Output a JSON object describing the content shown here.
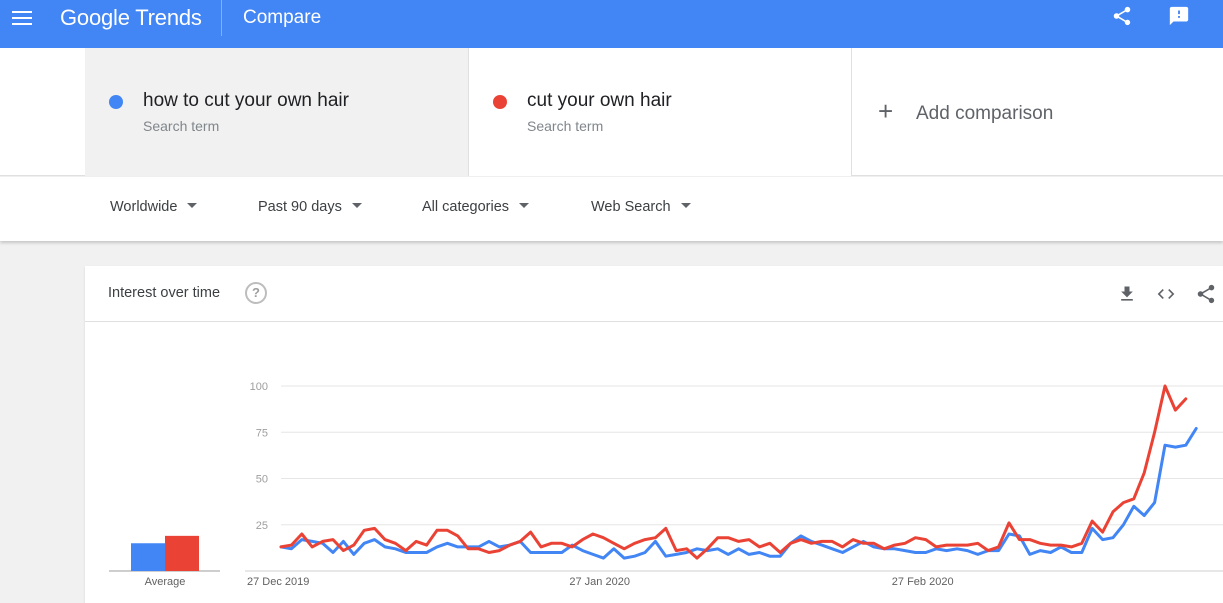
{
  "header": {
    "logo": "Google Trends",
    "title": "Compare",
    "bg_color": "#4285f4"
  },
  "icons": {
    "menu": "menu-icon",
    "share": "share-icon",
    "feedback": "feedback-icon",
    "help": "help-icon",
    "download": "download-icon",
    "embed": "embed-code-icon",
    "add": "plus-icon",
    "dropdown": "caret-down-icon"
  },
  "terms": [
    {
      "label": "how to cut your own hair",
      "sublabel": "Search term",
      "color": "#4285f4"
    },
    {
      "label": "cut your own hair",
      "sublabel": "Search term",
      "color": "#ea4335"
    }
  ],
  "add_comparison": {
    "plus": "+",
    "label": "Add comparison"
  },
  "filters": {
    "region": "Worldwide",
    "time": "Past 90 days",
    "category": "All categories",
    "search_type": "Web Search"
  },
  "card": {
    "title": "Interest over time",
    "help_glyph": "?"
  },
  "chart_data": {
    "type": "line",
    "title": "Interest over time",
    "xlabel": "",
    "ylabel": "",
    "ylim": [
      0,
      100
    ],
    "yticks": [
      25,
      50,
      75,
      100
    ],
    "x_tick_labels": [
      "27 Dec 2019",
      "27 Jan 2020",
      "27 Feb 2020"
    ],
    "x_tick_index": [
      0,
      31,
      62
    ],
    "grid": true,
    "average_label": "Average",
    "average": [
      {
        "name": "how to cut your own hair",
        "value": 15,
        "color": "#4285f4"
      },
      {
        "name": "cut your own hair",
        "value": 19,
        "color": "#ea4335"
      }
    ],
    "series": [
      {
        "name": "how to cut your own hair",
        "color": "#4285f4",
        "values": [
          13,
          12,
          17,
          16,
          15,
          10,
          16,
          9,
          15,
          17,
          13,
          12,
          10,
          10,
          10,
          13,
          15,
          13,
          13,
          13,
          16,
          13,
          14,
          16,
          10,
          10,
          10,
          10,
          14,
          11,
          9,
          7,
          12,
          7,
          8,
          10,
          16,
          8,
          9,
          10,
          12,
          11,
          12,
          9,
          12,
          9,
          10,
          8,
          8,
          15,
          19,
          16,
          14,
          12,
          10,
          13,
          16,
          13,
          12,
          12,
          11,
          10,
          10,
          12,
          11,
          12,
          11,
          9,
          11,
          11,
          20,
          19,
          9,
          11,
          10,
          13,
          10,
          10,
          23,
          17,
          18,
          25,
          35,
          30,
          37,
          68,
          67,
          68,
          77
        ]
      },
      {
        "name": "cut your own hair",
        "color": "#ea4335",
        "values": [
          13,
          14,
          20,
          13,
          16,
          17,
          11,
          14,
          22,
          23,
          17,
          15,
          11,
          16,
          14,
          22,
          22,
          19,
          12,
          12,
          10,
          11,
          14,
          16,
          21,
          13,
          15,
          15,
          13,
          17,
          20,
          18,
          15,
          12,
          15,
          17,
          18,
          23,
          11,
          12,
          7,
          12,
          18,
          18,
          16,
          17,
          13,
          15,
          10,
          15,
          17,
          15,
          16,
          16,
          13,
          17,
          15,
          15,
          12,
          14,
          15,
          18,
          17,
          13,
          14,
          14,
          14,
          15,
          11,
          13,
          26,
          17,
          17,
          15,
          14,
          14,
          13,
          15,
          27,
          21,
          32,
          37,
          39,
          53,
          75,
          100,
          87,
          93
        ]
      }
    ]
  }
}
